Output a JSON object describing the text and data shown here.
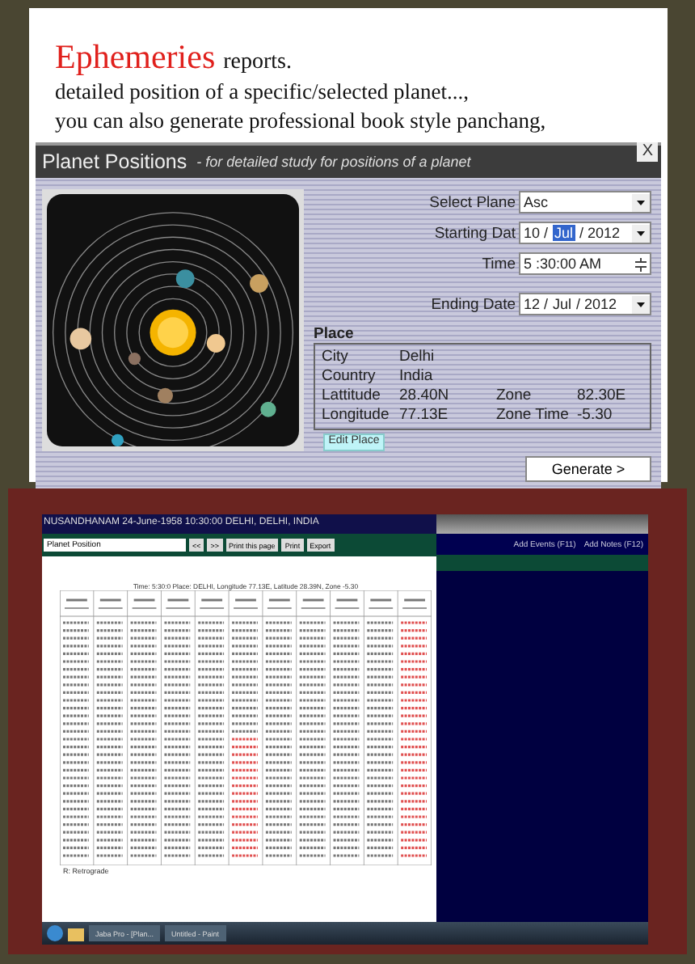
{
  "intro": {
    "title": "Ephemeries",
    "title_suffix": "reports.",
    "lines": [
      "detailed position of a specific/selected planet...,",
      "you can also generate professional book style panchang,"
    ]
  },
  "dialog": {
    "title": "Planet Positions",
    "subtitle": "- for detailed study for positions of a planet",
    "close": "X",
    "fields": [
      {
        "kind": "dropdown",
        "label": "Select Plane",
        "parts": [
          {
            "text": "Asc",
            "selected": false
          }
        ]
      },
      {
        "kind": "date",
        "label": "Starting Dat",
        "parts": [
          {
            "text": "10 /",
            "selected": false
          },
          {
            "text": "Jul",
            "selected": true
          },
          {
            "text": "/ 2012",
            "selected": false
          }
        ]
      },
      {
        "kind": "time",
        "label": "Time",
        "parts": [
          {
            "text": "5 :30:00 AM",
            "selected": false
          }
        ]
      },
      {
        "kind": "date",
        "label": "Ending Date",
        "parts": [
          {
            "text": "12 /",
            "selected": false
          },
          {
            "text": "Jul",
            "selected": false
          },
          {
            "text": "/ 2012",
            "selected": false
          }
        ]
      }
    ],
    "place": {
      "heading": "Place",
      "rows": [
        {
          "label": "City",
          "value": "Delhi"
        },
        {
          "label": "Country",
          "value": "India"
        },
        {
          "label": "Lattitude",
          "value": "28.40N",
          "label2": "Zone",
          "value2": "82.30E"
        },
        {
          "label": "Longitude",
          "value": "77.13E",
          "label2": "Zone Time",
          "value2": "-5.30"
        }
      ],
      "edit_button": "Edit Place"
    },
    "generate_button": "Generate >"
  },
  "screenshot": {
    "header": "NUSANDHANAM  24-June-1958  10:30:00  DELHI, DELHI, INDIA",
    "report_select": "Planet Position",
    "toolbar_buttons": [
      "<<",
      ">>",
      "Print this page",
      "Print",
      "Export"
    ],
    "nav_links": [
      "Add Events (F11)",
      "Add Notes (F12)"
    ],
    "table_subtitle": "Time: 5:30:0  Place: DELHI, Longitude 77.13E, Latitude 28.39N, Zone -5.30",
    "table_footer": "R: Retrograde",
    "taskbar_items": [
      "Jaba Pro - [Plan...",
      "Untitled - Paint"
    ]
  }
}
